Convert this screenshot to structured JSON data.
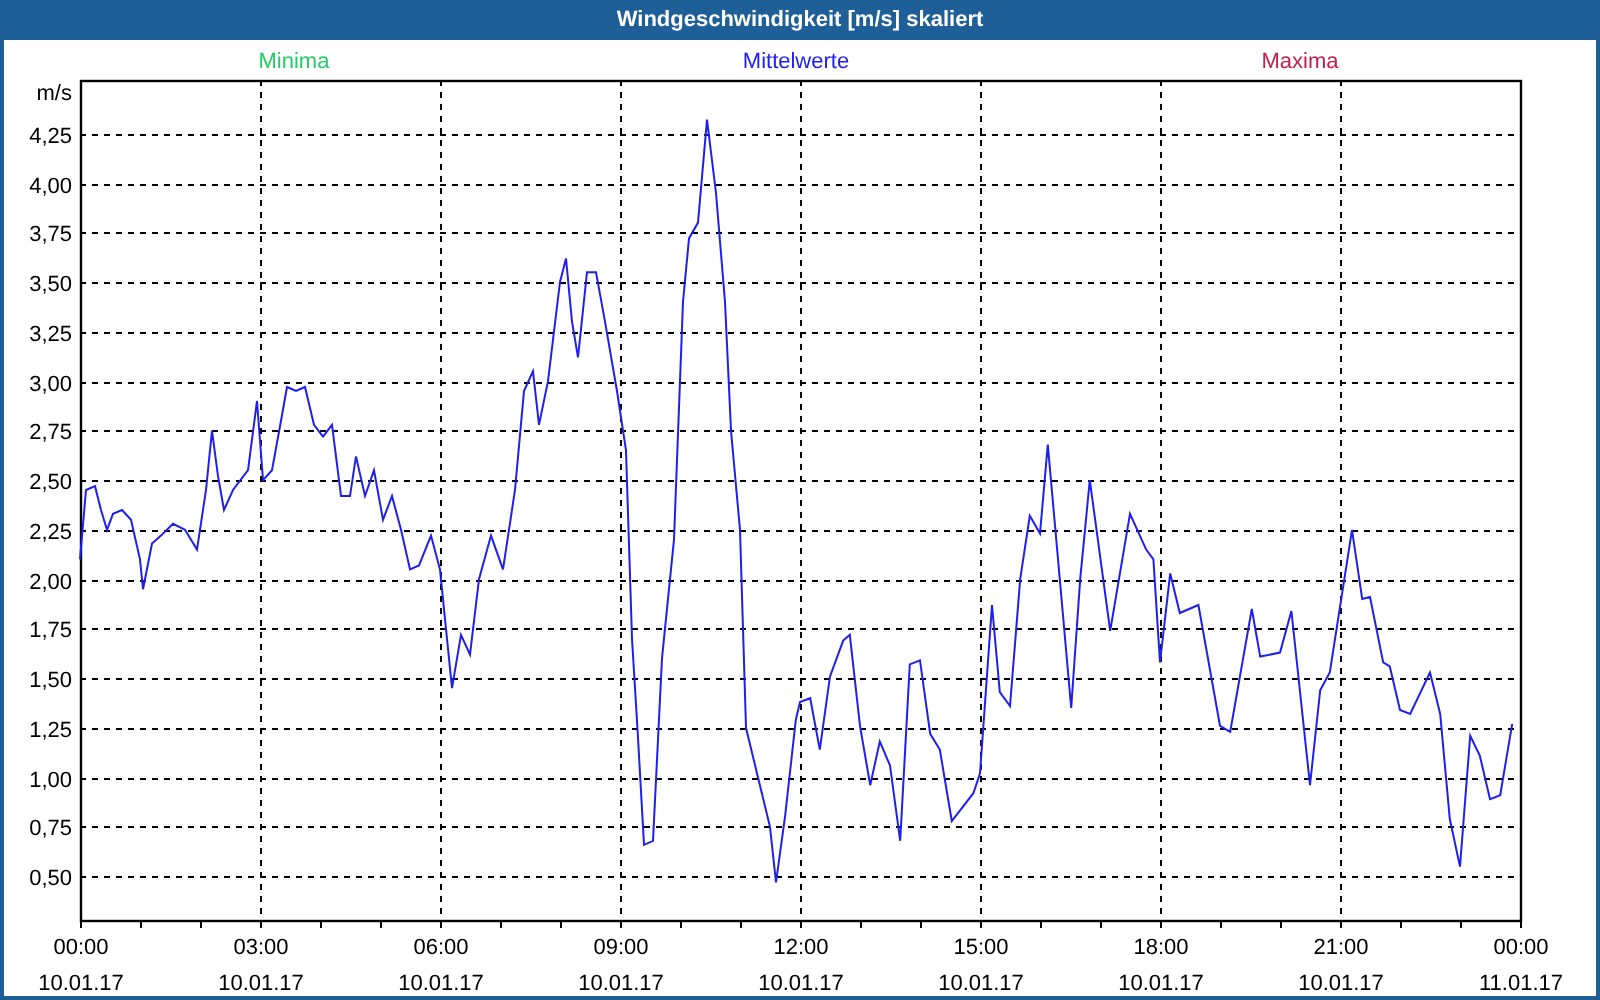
{
  "window": {
    "title": "Windgeschwindigkeit [m/s] skaliert"
  },
  "chart": {
    "legend": [
      {
        "label": "Minima",
        "color": "#22cc66"
      },
      {
        "label": "Maxima",
        "color": "#c02050"
      }
    ],
    "x_dates": [
      "10.01.17",
      "10.01.17",
      "10.01.17",
      "10.01.17",
      "10.01.17",
      "10.01.17",
      "10.01.17",
      "10.01.17",
      "11.01.17"
    ],
    "chart_data": {
      "type": "line",
      "grid": true,
      "ylabel": "m/s",
      "xlim": [
        0,
        24
      ],
      "ylim": [
        0.28,
        4.52
      ],
      "xticks": [
        {
          "value": 0,
          "label": "00:00"
        },
        {
          "value": 3,
          "label": "03:00"
        },
        {
          "value": 6,
          "label": "06:00"
        },
        {
          "value": 9,
          "label": "09:00"
        },
        {
          "value": 12,
          "label": "12:00"
        },
        {
          "value": 15,
          "label": "15:00"
        },
        {
          "value": 18,
          "label": "18:00"
        },
        {
          "value": 21,
          "label": "21:00"
        },
        {
          "value": 24,
          "label": "00:00"
        }
      ],
      "yticks": [
        {
          "value": 0.5,
          "label": "0,50"
        },
        {
          "value": 0.75,
          "label": "0,75"
        },
        {
          "value": 1,
          "label": "1,00"
        },
        {
          "value": 1.25,
          "label": "1,25"
        },
        {
          "value": 1.5,
          "label": "1,50"
        },
        {
          "value": 1.75,
          "label": "1,75"
        },
        {
          "value": 2,
          "label": "2,00"
        },
        {
          "value": 2.25,
          "label": "2,25"
        },
        {
          "value": 2.5,
          "label": "2,50"
        },
        {
          "value": 2.75,
          "label": "2,75"
        },
        {
          "value": 3,
          "label": "3,00"
        },
        {
          "value": 3.25,
          "label": "3,25"
        },
        {
          "value": 3.5,
          "label": "3,50"
        },
        {
          "value": 3.75,
          "label": "3,75"
        },
        {
          "value": 4,
          "label": "4,00"
        },
        {
          "value": 4.25,
          "label": "4,25"
        }
      ],
      "x": [
        0,
        0.1,
        0.25,
        0.35,
        0.45,
        0.55,
        0.7,
        0.85,
        1,
        1.05,
        1.2,
        1.35,
        1.55,
        1.75,
        1.95,
        2.1,
        2.2,
        2.3,
        2.4,
        2.55,
        2.8,
        2.95,
        3.05,
        3.2,
        3.35,
        3.45,
        3.6,
        3.75,
        3.9,
        4.05,
        4.2,
        4.35,
        4.5,
        4.6,
        4.75,
        4.9,
        5.05,
        5.2,
        5.35,
        5.5,
        5.65,
        5.85,
        6,
        6.1,
        6.2,
        6.35,
        6.5,
        6.65,
        6.85,
        7.05,
        7.25,
        7.4,
        7.55,
        7.65,
        7.8,
        8,
        8.1,
        8.2,
        8.3,
        8.45,
        8.6,
        8.75,
        8.95,
        9.1,
        9.2,
        9.3,
        9.4,
        9.55,
        9.7,
        9.9,
        10.05,
        10.15,
        10.3,
        10.45,
        10.6,
        10.75,
        10.85,
        11,
        11.1,
        11.3,
        11.5,
        11.6,
        11.75,
        11.93,
        12,
        12.17,
        12.33,
        12.5,
        12.72,
        12.83,
        13,
        13.17,
        13.33,
        13.5,
        13.67,
        13.83,
        14,
        14.17,
        14.33,
        14.53,
        14.89,
        15,
        15.2,
        15.33,
        15.5,
        15.67,
        15.83,
        16,
        16.13,
        16.33,
        16.52,
        16.67,
        16.83,
        17.17,
        17.5,
        17.77,
        17.89,
        18,
        18.17,
        18.33,
        18.64,
        19,
        19.17,
        19.53,
        19.67,
        20,
        20.19,
        20.5,
        20.67,
        20.83,
        21.2,
        21.37,
        21.5,
        21.72,
        21.83,
        22,
        22.17,
        22.5,
        22.67,
        22.83,
        23,
        23.17,
        23.33,
        23.5,
        23.67,
        23.87
      ],
      "series": [
        {
          "name": "Mittelwerte",
          "color": "#2020ee",
          "values": [
            2.1,
            2.45,
            2.47,
            2.35,
            2.25,
            2.33,
            2.35,
            2.3,
            2.1,
            1.95,
            2.18,
            2.22,
            2.28,
            2.25,
            2.15,
            2.45,
            2.75,
            2.52,
            2.35,
            2.45,
            2.55,
            2.9,
            2.5,
            2.55,
            2.8,
            2.97,
            2.95,
            2.97,
            2.78,
            2.72,
            2.78,
            2.42,
            2.42,
            2.62,
            2.42,
            2.55,
            2.3,
            2.42,
            2.25,
            2.05,
            2.07,
            2.22,
            2.05,
            1.75,
            1.45,
            1.72,
            1.62,
            2,
            2.22,
            2.05,
            2.45,
            2.95,
            3.05,
            2.78,
            3,
            3.5,
            3.62,
            3.3,
            3.12,
            3.55,
            3.55,
            3.3,
            2.95,
            2.65,
            1.7,
            1.2,
            0.66,
            0.68,
            1.6,
            2.2,
            3.4,
            3.72,
            3.8,
            4.32,
            3.95,
            3.4,
            2.75,
            2.25,
            1.25,
            1,
            0.75,
            0.47,
            0.8,
            1.29,
            1.38,
            1.4,
            1.14,
            1.51,
            1.69,
            1.72,
            1.26,
            0.96,
            1.18,
            1.06,
            0.68,
            1.57,
            1.59,
            1.22,
            1.14,
            0.78,
            0.92,
            1.02,
            1.87,
            1.43,
            1.36,
            2,
            2.32,
            2.23,
            2.68,
            2,
            1.35,
            2,
            2.5,
            1.74,
            2.33,
            2.15,
            2.1,
            1.58,
            2.03,
            1.83,
            1.87,
            1.26,
            1.23,
            1.85,
            1.61,
            1.63,
            1.84,
            0.96,
            1.44,
            1.53,
            2.25,
            1.9,
            1.91,
            1.58,
            1.56,
            1.34,
            1.32,
            1.53,
            1.32,
            0.79,
            0.55,
            1.21,
            1.11,
            0.89,
            0.91,
            1.27
          ]
        }
      ]
    }
  }
}
